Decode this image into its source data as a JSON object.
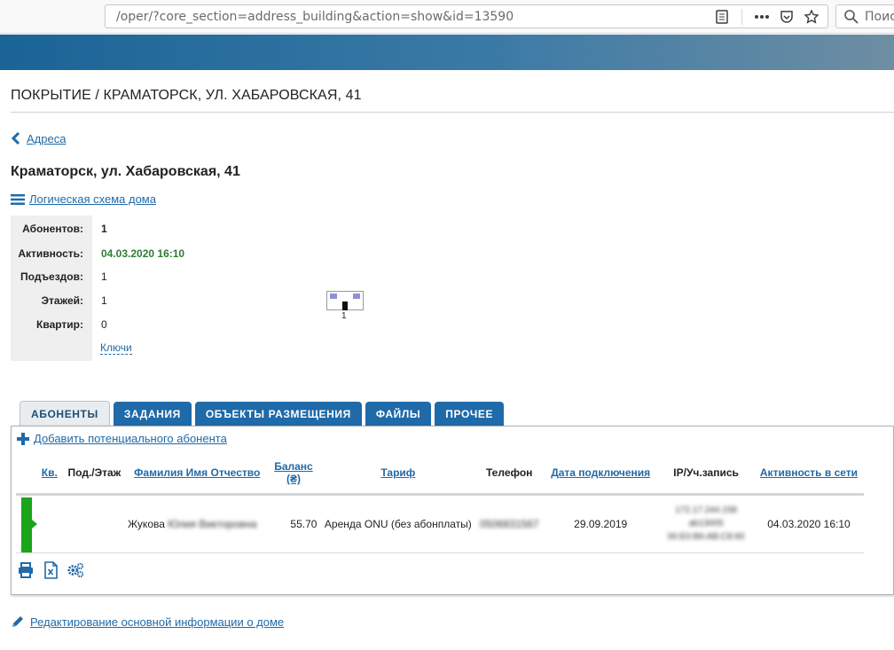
{
  "browser": {
    "url": "/oper/?core_section=address_building&action=show&id=13590",
    "search_placeholder": "Поиск"
  },
  "page": {
    "title": "ПОКРЫТИЕ / КРАМАТОРСК, УЛ. ХАБАРОВСКАЯ, 41",
    "back_link": "Адреса",
    "building_name": "Краматорск, ул. Хабаровская, 41",
    "scheme_link": "Логическая схема дома"
  },
  "info": {
    "rows": [
      {
        "label": "Абонентов:",
        "value": "1"
      },
      {
        "label": "Активность:",
        "value": "04.03.2020 16:10"
      },
      {
        "label": "Подъездов:",
        "value": "1"
      },
      {
        "label": "Этажей:",
        "value": "1"
      },
      {
        "label": "Квартир:",
        "value": "0"
      }
    ],
    "keys_link": "Ключи"
  },
  "mini_schema": {
    "entrance_number": "1"
  },
  "tabs": [
    {
      "label": "АБОНЕНТЫ",
      "active": true
    },
    {
      "label": "ЗАДАНИЯ",
      "active": false
    },
    {
      "label": "ОБЪЕКТЫ РАЗМЕЩЕНИЯ",
      "active": false
    },
    {
      "label": "ФАЙЛЫ",
      "active": false
    },
    {
      "label": "ПРОЧЕЕ",
      "active": false
    }
  ],
  "subscribers": {
    "add_link": "Добавить потенциального абонента",
    "columns": {
      "apt": "Кв.",
      "entrance_floor": "Под./Этаж",
      "name": "Фамилия Имя Отчество",
      "balance_line1": "Баланс",
      "balance_line2": "(₴)",
      "tariff": "Тариф",
      "phone": "Телефон",
      "connect_date": "Дата подключения",
      "ip_account": "IP/Уч.запись",
      "activity": "Активность в сети"
    },
    "rows": [
      {
        "apt": "",
        "entrance_floor": "",
        "surname": "Жукова",
        "name_hidden": "Юлия Викторовна",
        "balance": "55.70",
        "tariff": "Аренда ONU (без абонплаты)",
        "phone": "0506831567",
        "connect_date": "29.09.2019",
        "ip_line1": "172.17.244.158",
        "ip_line2": "ab13005",
        "ip_line3": "00:E0:B6:AB:C8:60",
        "activity": "04.03.2020 16:10",
        "status_color": "#1aa51a"
      }
    ]
  },
  "footer": {
    "edit_link": "Редактирование основной информации о доме"
  },
  "colors": {
    "link": "#1f6aa8",
    "tab": "#1f6aa8",
    "activity_green": "#2e7d32"
  }
}
